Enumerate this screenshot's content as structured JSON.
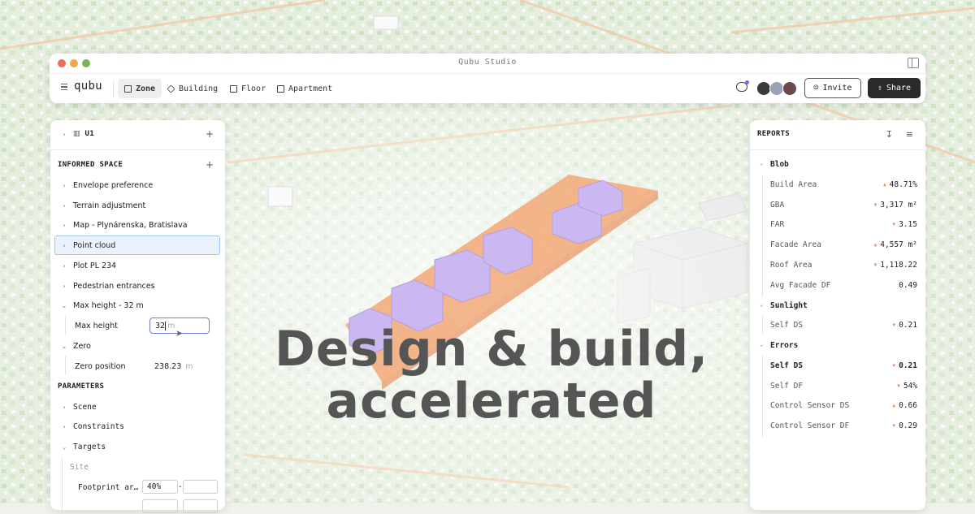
{
  "window": {
    "title": "Qubu Studio"
  },
  "toolbar": {
    "logo": "qubu",
    "tabs": [
      {
        "label": "Zone",
        "active": true
      },
      {
        "label": "Building",
        "active": false
      },
      {
        "label": "Floor",
        "active": false
      },
      {
        "label": "Apartment",
        "active": false
      }
    ],
    "invite_label": "Invite",
    "share_label": "Share"
  },
  "left_panel": {
    "zone_name": "U1",
    "informed_space_title": "INFORMED SPACE",
    "items": [
      "Envelope preference",
      "Terrain adjustment",
      "Map - Plynárenska, Bratislava",
      "Point cloud",
      "Plot PL 234",
      "Pedestrian entrances",
      "Max height - 32 m"
    ],
    "max_height_label": "Max height",
    "max_height_value": "32",
    "max_height_unit": "m",
    "zero_label": "Zero",
    "zero_position_label": "Zero position",
    "zero_position_value": "238.23",
    "zero_position_unit": "m",
    "parameters_title": "PARAMETERS",
    "param_items": [
      "Scene",
      "Constraints",
      "Targets"
    ],
    "site_label": "Site",
    "footprint_label": "Footprint ar…",
    "footprint_value": "40%",
    "footprint_sep": "-"
  },
  "right_panel": {
    "title": "REPORTS",
    "sections": [
      {
        "name": "Blob",
        "rows": [
          {
            "label": "Build Area",
            "value": "48.71%",
            "trend": "up"
          },
          {
            "label": "GBA",
            "value": "3,317 m²",
            "trend": "down"
          },
          {
            "label": "FAR",
            "value": "3.15",
            "trend": "down"
          },
          {
            "label": "Facade Area",
            "value": "4,557 m²",
            "trend": "up"
          },
          {
            "label": "Roof Area",
            "value": "1,118.22",
            "trend": "down"
          },
          {
            "label": "Avg Facade DF",
            "value": "0.49",
            "trend": "none"
          }
        ]
      },
      {
        "name": "Sunlight",
        "rows": [
          {
            "label": "Self DS",
            "value": "0.21",
            "trend": "down"
          }
        ]
      },
      {
        "name": "Errors",
        "rows": [
          {
            "label": "Self DS",
            "value": "0.21",
            "trend": "down",
            "bold": true
          },
          {
            "label": "Self DF",
            "value": "54%",
            "trend": "down"
          },
          {
            "label": "Control Sensor DS",
            "value": "0.66",
            "trend": "up"
          },
          {
            "label": "Control Sensor DF",
            "value": "0.29",
            "trend": "down"
          }
        ]
      }
    ]
  },
  "headline": {
    "line1": "Design & build,",
    "line2": "accelerated"
  },
  "colors": {
    "accent": "#6b7bd8",
    "trend": "#e08d5a",
    "massing": "#c9b4ef",
    "plot": "#f2a877"
  }
}
